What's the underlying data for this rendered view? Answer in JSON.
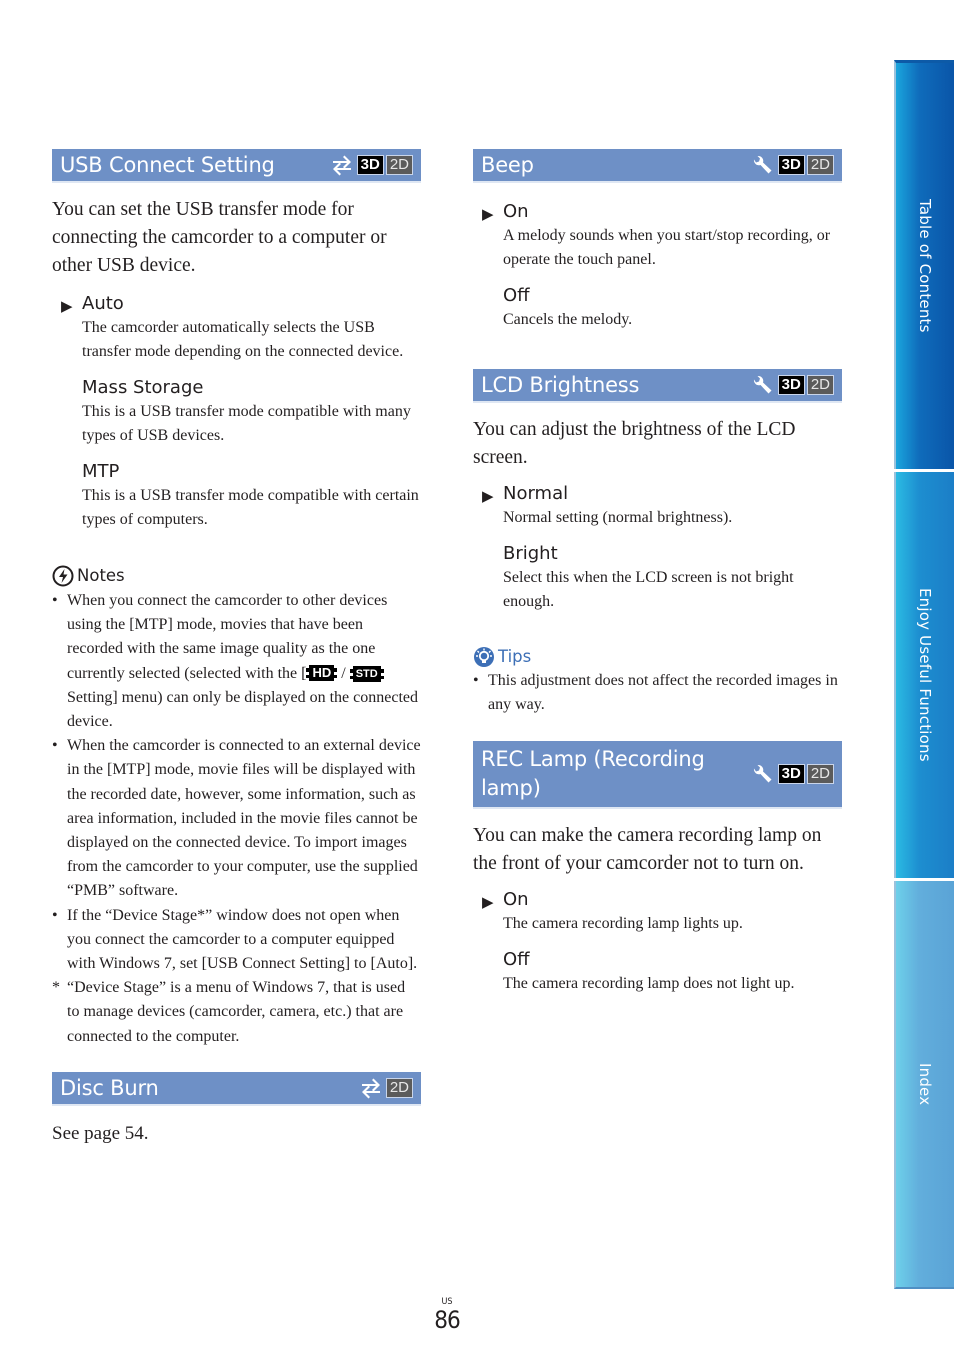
{
  "page": {
    "locale": "US",
    "number": "86"
  },
  "side_tabs": [
    {
      "label": "Table of Contents"
    },
    {
      "label": "Enjoy Useful Functions"
    },
    {
      "label": "Index"
    }
  ],
  "colors": {
    "section_header_bg": "#6e90c6",
    "tips_accent": "#3d6fb6",
    "badge_3d_bg": "#000000",
    "badge_2d_bg": "#5b5b5b"
  },
  "sections": {
    "usb": {
      "title": "USB Connect Setting",
      "icon": "transfer-arrows-icon",
      "badges": [
        "3D",
        "2D"
      ],
      "lead": "You can set the USB transfer mode for connecting the camcorder to a computer or other USB device.",
      "options": [
        {
          "name": "Auto",
          "default": true,
          "desc": "The camcorder automatically selects the USB transfer mode depending on the connected device."
        },
        {
          "name": "Mass Storage",
          "default": false,
          "desc": "This is a USB transfer mode compatible with many types of USB devices."
        },
        {
          "name": "MTP",
          "default": false,
          "desc": "This is a USB transfer mode compatible with certain types of computers."
        }
      ],
      "notes": {
        "label": "Notes",
        "items": [
          {
            "pre": "When you connect the camcorder to other devices using the [MTP] mode, movies that have been recorded with the same image quality as the one currently selected (selected with the [",
            "icon_hd": "HD",
            "sep": " / ",
            "icon_std": "STD",
            "post": " Setting] menu) can only be displayed on the connected device."
          },
          {
            "text": "When the camcorder is connected to an external device in the [MTP] mode, movie files will be displayed with the recorded date, however, some information, such as area information, included in the movie files cannot be displayed on the connected device. To import images from the camcorder to your computer, use the supplied “PMB” software."
          },
          {
            "text": "If the “Device Stage*” window does not open when you connect the camcorder to a computer equipped with Windows 7, set [USB Connect Setting] to [Auto]."
          }
        ],
        "footnote_mark": "*",
        "footnote": "“Device Stage” is a menu of Windows 7, that is used to manage devices (camcorder, camera, etc.) that are connected to the computer."
      }
    },
    "disc_burn": {
      "title": "Disc Burn",
      "icon": "transfer-arrows-icon",
      "badges": [
        "2D"
      ],
      "body": "See page 54."
    },
    "beep": {
      "title": "Beep",
      "icon": "wrench-icon",
      "badges": [
        "3D",
        "2D"
      ],
      "options": [
        {
          "name": "On",
          "default": true,
          "desc": "A melody sounds when you start/stop recording, or operate the touch panel."
        },
        {
          "name": "Off",
          "default": false,
          "desc": "Cancels the melody."
        }
      ]
    },
    "lcd": {
      "title": "LCD Brightness",
      "icon": "wrench-icon",
      "badges": [
        "3D",
        "2D"
      ],
      "lead": "You can adjust the brightness of the LCD screen.",
      "options": [
        {
          "name": "Normal",
          "default": true,
          "desc": "Normal setting (normal brightness)."
        },
        {
          "name": "Bright",
          "default": false,
          "desc": "Select this when the LCD screen is not bright enough."
        }
      ],
      "tips": {
        "label": "Tips",
        "items": [
          "This adjustment does not affect the recorded images in any way."
        ]
      }
    },
    "rec_lamp": {
      "title": "REC Lamp (Recording lamp)",
      "icon": "wrench-icon",
      "badges": [
        "3D",
        "2D"
      ],
      "lead": "You can make the camera recording lamp on the front of your camcorder not to turn on.",
      "options": [
        {
          "name": "On",
          "default": true,
          "desc": "The camera recording lamp lights up."
        },
        {
          "name": "Off",
          "default": false,
          "desc": "The camera recording lamp does not light up."
        }
      ]
    }
  },
  "glyphs": {
    "default_marker": "▶",
    "bullet": "•"
  }
}
